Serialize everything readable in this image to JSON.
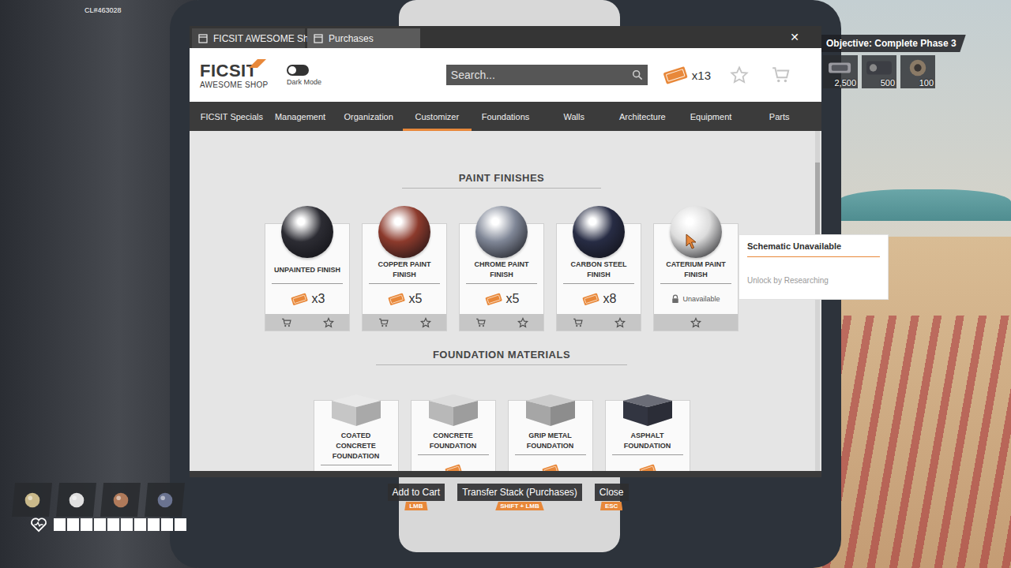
{
  "hud": {
    "build_id": "CL#463028",
    "objective": {
      "label": "Objective: Complete Phase 3",
      "items": [
        {
          "count": "2,500"
        },
        {
          "count": "500"
        },
        {
          "count": "100"
        }
      ]
    },
    "hotbar": [
      {
        "filled": true
      },
      {
        "filled": true
      },
      {
        "filled": true
      },
      {
        "filled": true
      }
    ],
    "health": {
      "level": 1
    }
  },
  "window": {
    "tabs": [
      {
        "label": "FICSIT AWESOME Sho",
        "selected": true
      },
      {
        "label": "Purchases",
        "selected": false
      }
    ],
    "close": "✕"
  },
  "header": {
    "logo_top": "FICSIT",
    "logo_bottom": "AWESOME SHOP",
    "dark_mode": {
      "label": "Dark Mode",
      "on": false
    },
    "search": {
      "placeholder": "Search..."
    },
    "coupons": "x13"
  },
  "nav": [
    {
      "label": "FICSIT Specials",
      "selected": false
    },
    {
      "label": "Management",
      "selected": false
    },
    {
      "label": "Organization",
      "selected": false
    },
    {
      "label": "Customizer",
      "selected": true
    },
    {
      "label": "Foundations",
      "selected": false
    },
    {
      "label": "Walls",
      "selected": false
    },
    {
      "label": "Architecture",
      "selected": false
    },
    {
      "label": "Equipment",
      "selected": false
    },
    {
      "label": "Parts",
      "selected": false
    }
  ],
  "sections": [
    {
      "title": "PAINT FINISHES",
      "kind": "paint",
      "items": [
        {
          "name": "UNPAINTED FINISH",
          "price": "x3",
          "available": true,
          "color": "#2c2c33"
        },
        {
          "name": "COPPER PAINT FINISH",
          "price": "x5",
          "available": true,
          "color": "#8c3a2c"
        },
        {
          "name": "CHROME PAINT FINISH",
          "price": "x5",
          "available": true,
          "color": "#7f8696"
        },
        {
          "name": "CARBON STEEL FINISH",
          "price": "x8",
          "available": true,
          "color": "#272c44"
        },
        {
          "name": "CATERIUM PAINT FINISH",
          "status": "Unavailable",
          "available": false,
          "color": "#dcdcdc"
        }
      ]
    },
    {
      "title": "FOUNDATION MATERIALS",
      "kind": "foundation",
      "items": [
        {
          "name": "COATED CONCRETE FOUNDATION",
          "available": false,
          "color": "#e2e2e2"
        },
        {
          "name": "CONCRETE FOUNDATION",
          "available": true,
          "color": "#d2d2d2"
        },
        {
          "name": "GRIP METAL FOUNDATION",
          "available": true,
          "color": "#bdbdbd"
        },
        {
          "name": "ASPHALT FOUNDATION",
          "available": true,
          "color": "#3a3d4a"
        }
      ]
    }
  ],
  "tooltip": {
    "title": "Schematic Unavailable",
    "text": "Unlock by Researching"
  },
  "hints": [
    {
      "label": "Add to Cart",
      "key": "LMB"
    },
    {
      "label": "Transfer Stack (Purchases)",
      "key": "SHIFT + LMB"
    },
    {
      "label": "Close",
      "key": "ESC"
    }
  ]
}
